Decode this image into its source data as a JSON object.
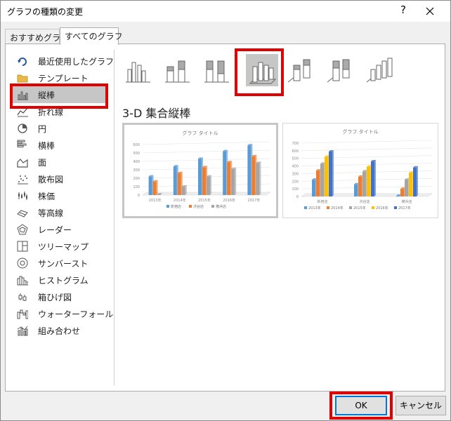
{
  "dialog": {
    "title": "グラフの種類の変更",
    "help_label": "?"
  },
  "tabs": [
    {
      "label": "おすすめグラフ"
    },
    {
      "label": "すべてのグラフ"
    }
  ],
  "categories": [
    {
      "label": "最近使用したグラフ",
      "icon": "recent-icon"
    },
    {
      "label": "テンプレート",
      "icon": "folder-icon"
    },
    {
      "label": "縦棒",
      "icon": "column-chart-icon"
    },
    {
      "label": "折れ線",
      "icon": "line-chart-icon"
    },
    {
      "label": "円",
      "icon": "pie-chart-icon"
    },
    {
      "label": "横棒",
      "icon": "bar-chart-icon"
    },
    {
      "label": "面",
      "icon": "area-chart-icon"
    },
    {
      "label": "散布図",
      "icon": "scatter-chart-icon"
    },
    {
      "label": "株価",
      "icon": "stock-chart-icon"
    },
    {
      "label": "等高線",
      "icon": "surface-chart-icon"
    },
    {
      "label": "レーダー",
      "icon": "radar-chart-icon"
    },
    {
      "label": "ツリーマップ",
      "icon": "treemap-chart-icon"
    },
    {
      "label": "サンバースト",
      "icon": "sunburst-chart-icon"
    },
    {
      "label": "ヒストグラム",
      "icon": "histogram-chart-icon"
    },
    {
      "label": "箱ひげ図",
      "icon": "box-whisker-chart-icon"
    },
    {
      "label": "ウォーターフォール",
      "icon": "waterfall-chart-icon"
    },
    {
      "label": "組み合わせ",
      "icon": "combo-chart-icon"
    }
  ],
  "selected_category": "縦棒",
  "subtype_heading": "3-D 集合縦棒",
  "previews": [
    {
      "title": "グラフ タイトル",
      "categories": [
        "2013年",
        "2014年",
        "2015年",
        "2016年",
        "2017年"
      ],
      "y_ticks": [
        "600",
        "500",
        "400",
        "300",
        "200",
        "100",
        "0"
      ],
      "legend": [
        "新宿店",
        "渋谷店",
        "横浜店"
      ],
      "colors": [
        "#5b9bd5",
        "#ed7d31",
        "#a5a5a5"
      ],
      "values": [
        [
          220,
          340,
          430,
          520,
          590
        ],
        [
          160,
          260,
          330,
          390,
          460
        ],
        [
          0,
          100,
          220,
          310,
          380
        ]
      ]
    },
    {
      "title": "グラフ タイトル",
      "categories": [
        "新宿店",
        "渋谷店",
        "横浜店"
      ],
      "y_ticks": [
        "700",
        "600",
        "500",
        "400",
        "300",
        "200",
        "100",
        "0"
      ],
      "legend": [
        "2013年",
        "2014年",
        "2015年",
        "2016年",
        "2017年"
      ],
      "colors": [
        "#5b9bd5",
        "#ed7d31",
        "#a5a5a5",
        "#ffc000",
        "#4472c4"
      ],
      "values": [
        [
          220,
          160,
          0
        ],
        [
          340,
          260,
          100
        ],
        [
          430,
          330,
          220
        ],
        [
          520,
          390,
          310
        ],
        [
          590,
          460,
          380
        ]
      ]
    }
  ],
  "buttons": {
    "ok": "OK",
    "cancel": "キャンセル"
  }
}
